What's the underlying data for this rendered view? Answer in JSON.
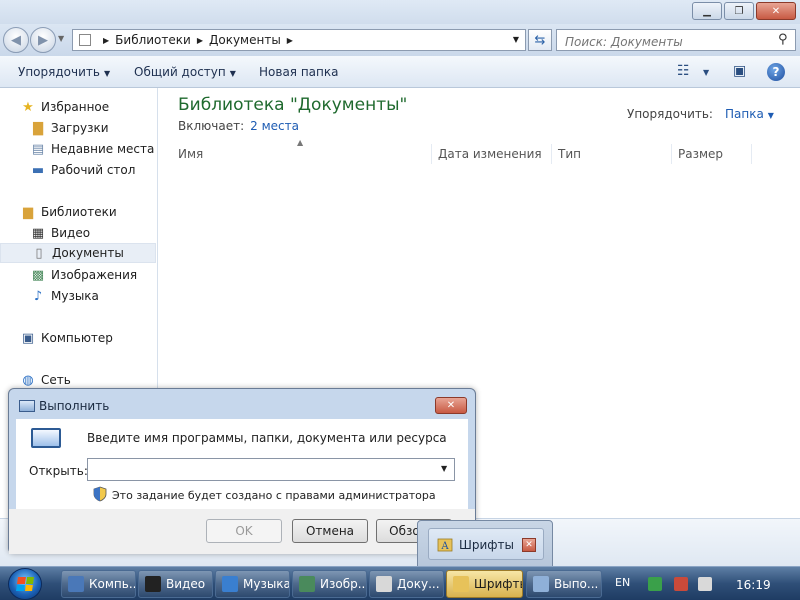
{
  "explorer": {
    "address": {
      "seg1": "Библиотеки",
      "seg2": "Документы"
    },
    "search": {
      "placeholder": "Поиск: Документы"
    },
    "toolbar": {
      "organize": "Упорядочить",
      "share": "Общий доступ",
      "new_folder": "Новая папка"
    },
    "navpane": {
      "favorites": {
        "label": "Избранное",
        "items": [
          "Загрузки",
          "Недавние места",
          "Рабочий стол"
        ]
      },
      "libraries": {
        "label": "Библиотеки",
        "items": [
          "Видео",
          "Документы",
          "Изображения",
          "Музыка"
        ]
      },
      "computer": "Компьютер",
      "network": "Сеть"
    },
    "content": {
      "title": "Библиотека \"Документы\"",
      "includes_label": "Включает:",
      "includes_link": "2 места",
      "arrange_label": "Упорядочить:",
      "arrange_value": "Папка",
      "columns": [
        "Имя",
        "Дата изменения",
        "Тип",
        "Размер"
      ]
    }
  },
  "run_dialog": {
    "title": "Выполнить",
    "description": "Введите имя программы, папки, документа или ресурса",
    "open_label": "Открыть:",
    "open_value": "",
    "admin_note": "Это задание будет создано с правами администратора",
    "buttons": {
      "ok": "OK",
      "cancel": "Отмена",
      "browse": "Обзор..."
    }
  },
  "thumbnail": {
    "label": "Шрифты"
  },
  "taskbar": {
    "buttons": [
      "Компь...",
      "Видео",
      "Музыка",
      "Изобр...",
      "Доку...",
      "Шрифты",
      "Выпо..."
    ],
    "language": "EN",
    "clock": "16:19"
  },
  "colors": {
    "accent_green": "#1f6a2e",
    "link_blue": "#1e5cb3",
    "taskbar": "#2f4f78"
  }
}
